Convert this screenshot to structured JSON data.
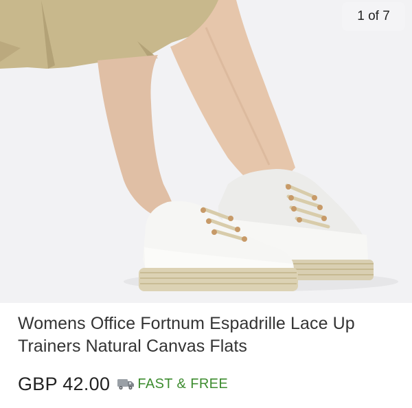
{
  "gallery": {
    "counter": "1 of 7"
  },
  "product": {
    "title": "Womens Office Fortnum Espadrille Lace Up Trainers Natural Canvas Flats",
    "price": "GBP 42.00",
    "shipping": "FAST & FREE"
  },
  "icons": {
    "shipping": "truck-icon"
  },
  "colors": {
    "shipping_text": "#3d8c2f",
    "image_background": "#f1f1f3",
    "price_text": "#222222"
  }
}
